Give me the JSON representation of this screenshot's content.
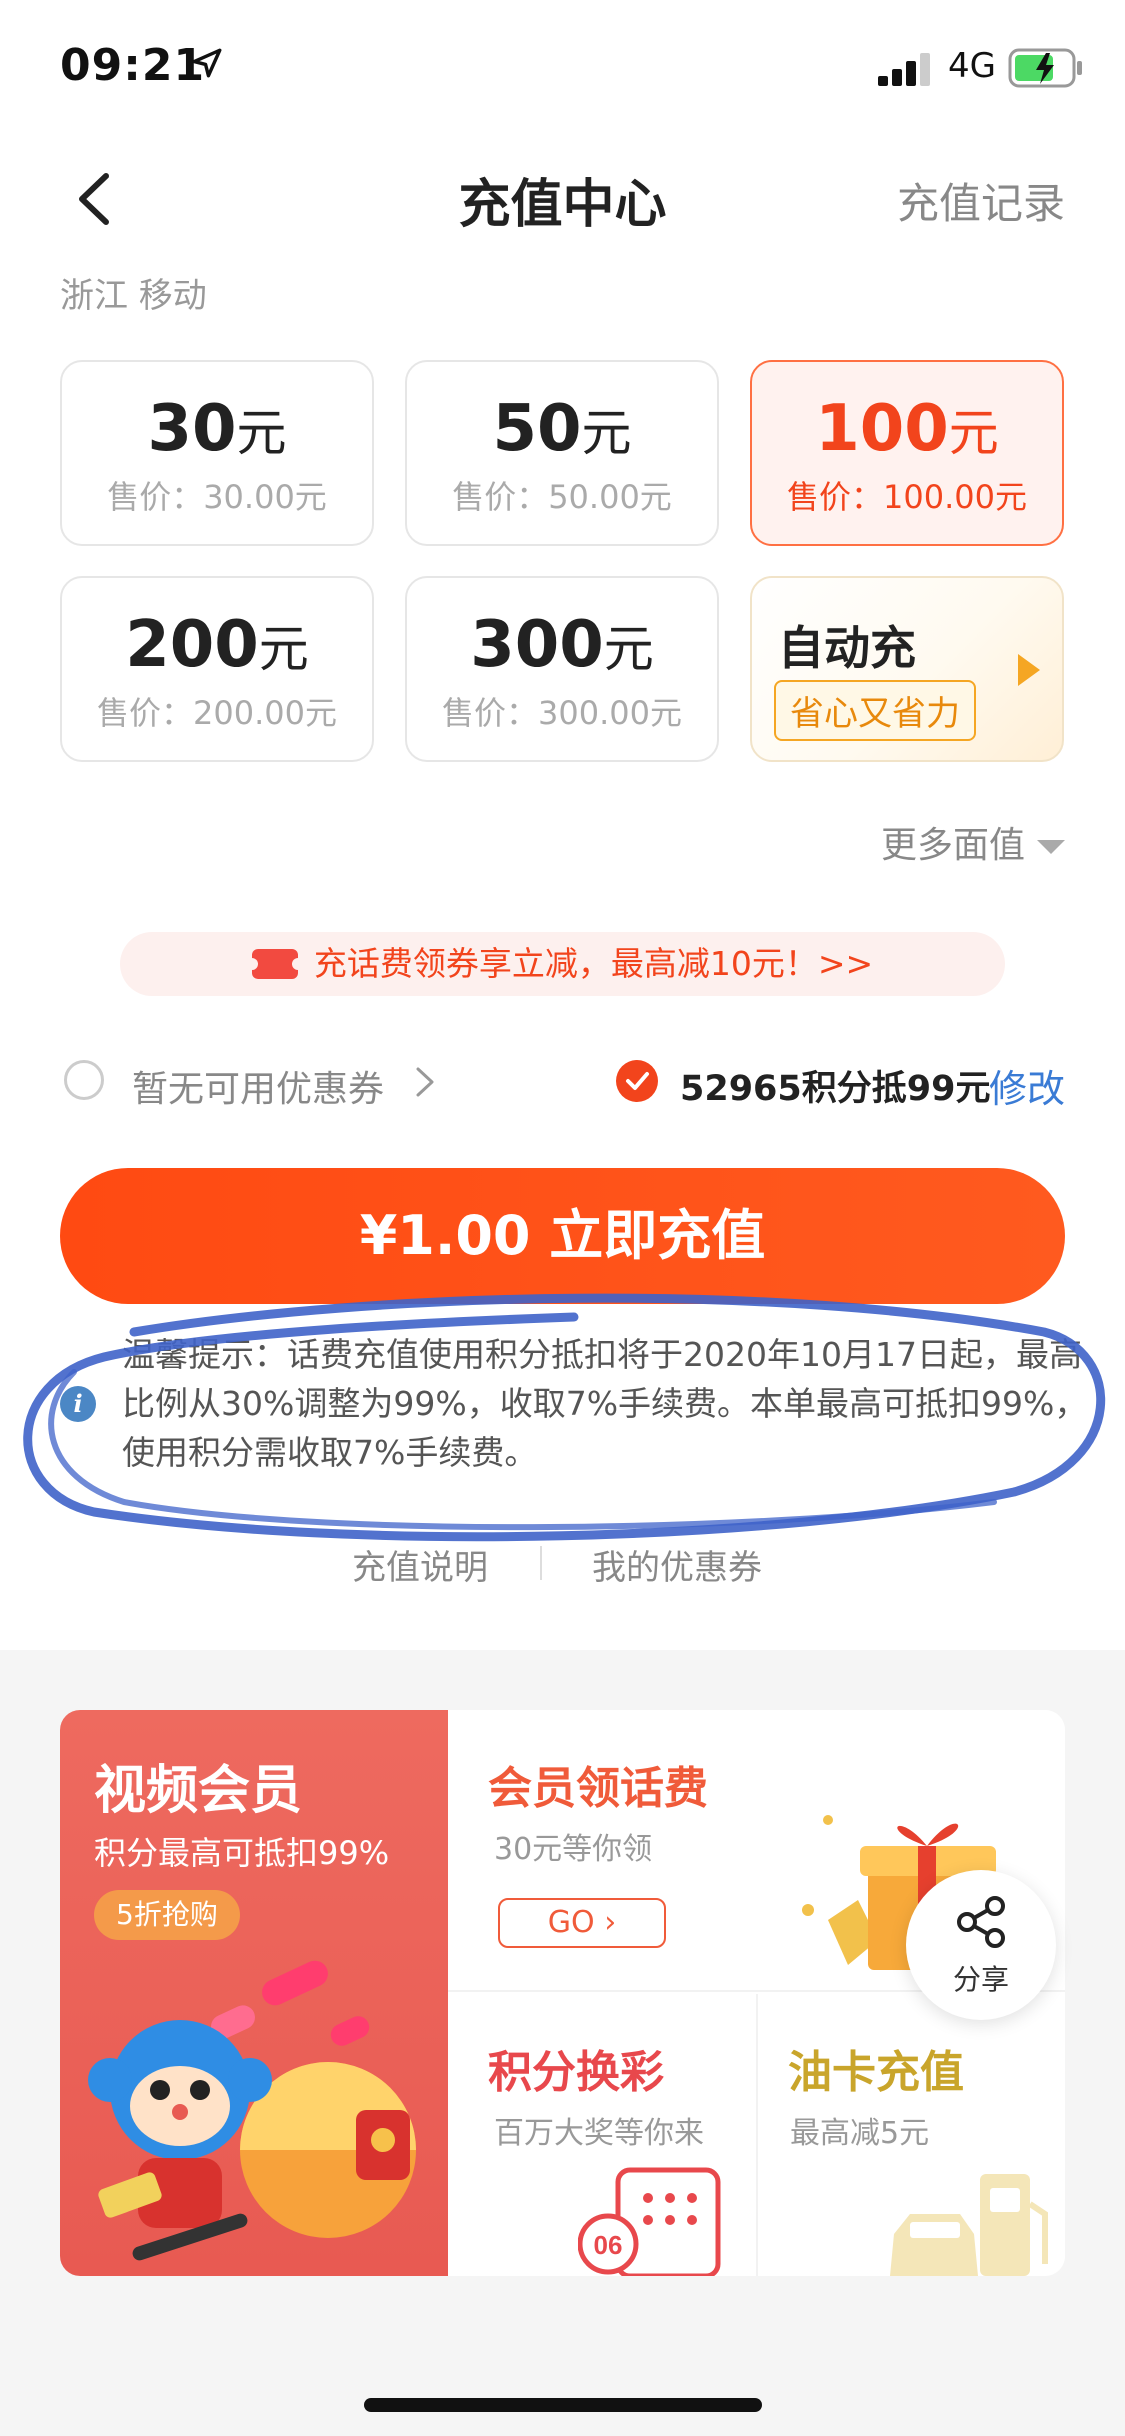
{
  "status_bar": {
    "time": "09:21",
    "network": "4G"
  },
  "nav": {
    "title": "充值中心",
    "right_label": "充值记录"
  },
  "region": "浙江 移动",
  "denominations": [
    {
      "amount": "30",
      "unit": "元",
      "price": "售价：30.00元"
    },
    {
      "amount": "50",
      "unit": "元",
      "price": "售价：50.00元"
    },
    {
      "amount": "100",
      "unit": "元",
      "price": "售价：100.00元"
    },
    {
      "amount": "200",
      "unit": "元",
      "price": "售价：200.00元"
    },
    {
      "amount": "300",
      "unit": "元",
      "price": "售价：300.00元"
    }
  ],
  "auto_recharge": {
    "title": "自动充",
    "tag": "省心又省力"
  },
  "more_values": "更多面值",
  "promo_banner": "充话费领券享立减，最高减10元！>>",
  "coupon": {
    "label": "暂无可用优惠券",
    "points": "52965积分抵99元",
    "modify": "修改"
  },
  "pay_button": "¥1.00 立即充值",
  "tip": {
    "icon": "i",
    "text": "温馨提示：话费充值使用积分抵扣将于2020年10月17日起，最高比例从30%调整为99%，收取7%手续费。本单最高可抵扣99%，使用积分需收取7%手续费。"
  },
  "links": {
    "instructions": "充值说明",
    "my_coupons": "我的优惠券"
  },
  "promos": {
    "vip": {
      "title": "视频会员",
      "subtitle": "积分最高可抵扣99%",
      "badge": "5折抢购"
    },
    "member_fee": {
      "title": "会员领话费",
      "subtitle": "30元等你领",
      "go": "GO"
    },
    "lottery": {
      "title": "积分换彩",
      "subtitle": "百万大奖等你来",
      "ticket_no": "06"
    },
    "fuel": {
      "title": "油卡充值",
      "subtitle": "最高减5元"
    }
  },
  "share": {
    "label": "分享"
  },
  "colors": {
    "accent": "#f2441c",
    "link": "#3a7bd5",
    "annotation": "#3f63c9"
  }
}
